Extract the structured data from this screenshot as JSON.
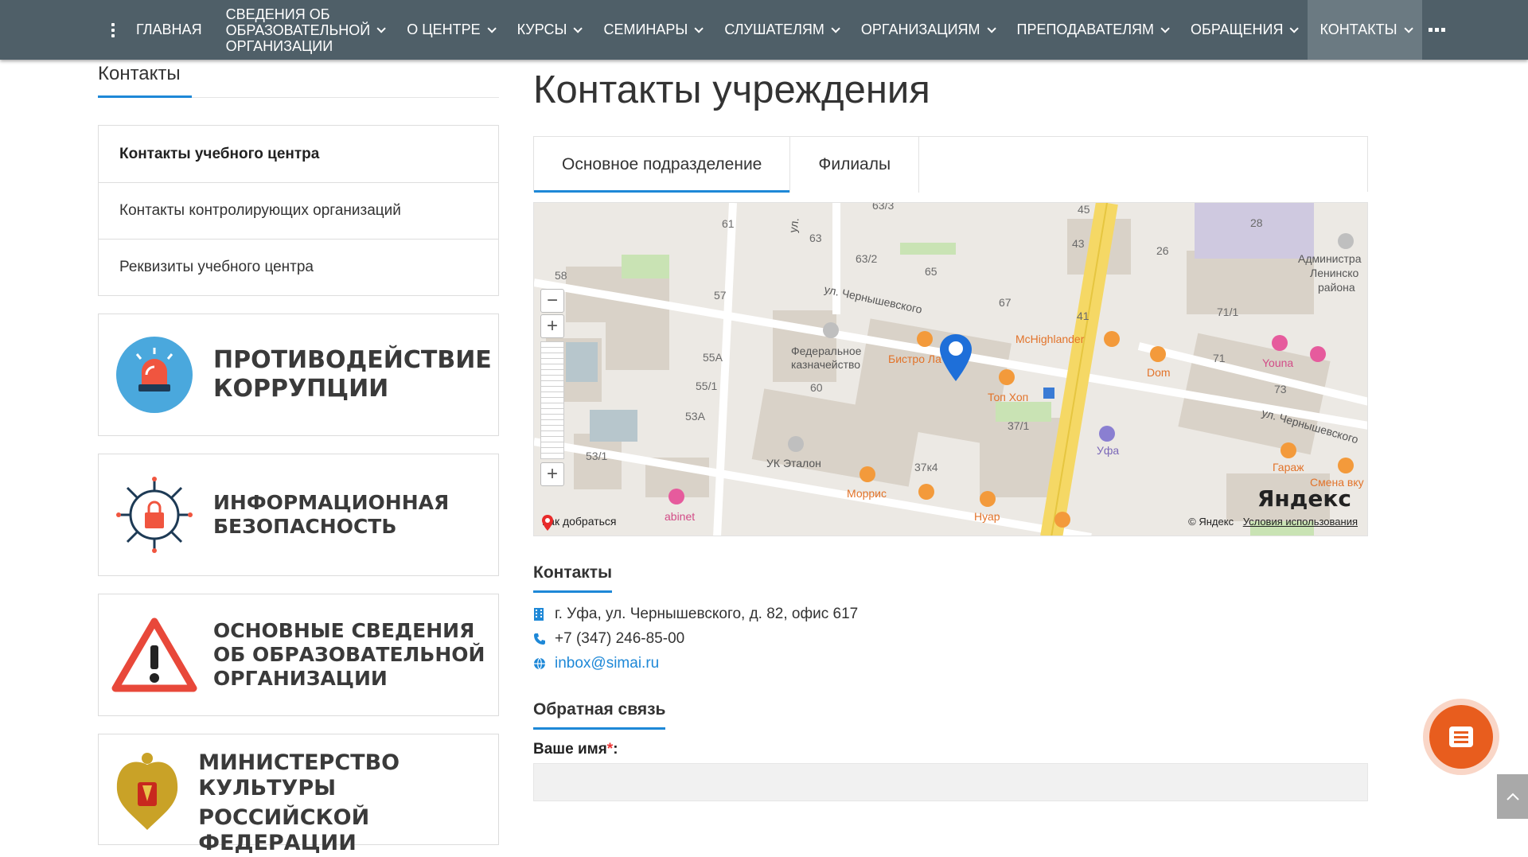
{
  "nav": {
    "items": [
      {
        "label": "ГЛАВНАЯ",
        "chevron": false
      },
      {
        "label": "СВЕДЕНИЯ ОБ ОБРАЗОВАТЕЛЬНОЙ ОРГАНИЗАЦИИ",
        "chevron": true
      },
      {
        "label": "О ЦЕНТРЕ",
        "chevron": true
      },
      {
        "label": "КУРСЫ",
        "chevron": true
      },
      {
        "label": "СЕМИНАРЫ",
        "chevron": true
      },
      {
        "label": "СЛУШАТЕЛЯМ",
        "chevron": true
      },
      {
        "label": "ОРГАНИЗАЦИЯМ",
        "chevron": true
      },
      {
        "label": "ПРЕПОДАВАТЕЛЯМ",
        "chevron": true
      },
      {
        "label": "ОБРАЩЕНИЯ",
        "chevron": true
      },
      {
        "label": "КОНТАКТЫ",
        "chevron": true
      }
    ],
    "nav_item_2_line1": "СВЕДЕНИЯ ОБ",
    "nav_item_2_line2": "ОБРАЗОВАТЕЛЬНОЙ",
    "nav_item_2_line3": "ОРГАНИЗАЦИИ",
    "active": "КОНТАКТЫ"
  },
  "sidebar": {
    "title": "Контакты",
    "menu": [
      "Контакты учебного центра",
      "Контакты контролирующих организаций",
      "Реквизиты учебного центра"
    ],
    "banners": [
      {
        "line1": "ПРОТИВОДЕЙСТВИЕ",
        "line2": "КОРРУПЦИИ",
        "icon": "siren-icon"
      },
      {
        "line1": "ИНФОРМАЦИОННАЯ",
        "line2": "БЕЗОПАСНОСТЬ",
        "icon": "lock-circuit-icon"
      },
      {
        "line1": "ОСНОВНЫЕ СВЕДЕНИЯ",
        "line2": "ОБ ОБРАЗОВАТЕЛЬНОЙ",
        "line3": "ОРГАНИЗАЦИИ",
        "icon": "warning-icon"
      },
      {
        "line1": "МИНИСТЕРСТВО КУЛЬТУРЫ",
        "line2": "РОССИЙСКОЙ ФЕДЕРАЦИИ",
        "icon": "coat-of-arms-icon"
      }
    ]
  },
  "main": {
    "title": "Контакты учреждения",
    "tabs": [
      "Основное подразделение",
      "Филиалы"
    ],
    "map": {
      "labels": {
        "n61": "61",
        "n63_3": "63/3",
        "n63": "63",
        "n63_2": "63/2",
        "n65": "65",
        "n45": "45",
        "n43": "43",
        "n28": "28",
        "n26": "26",
        "n58": "58",
        "n57": "57",
        "n67": "67",
        "n41": "41",
        "n71_1": "71/1",
        "n55a": "55А",
        "n55_1": "55/1",
        "n53a": "53А",
        "n60": "60",
        "n53_1": "53/1",
        "n37_1": "37/1",
        "n37k4": "37к4",
        "n71": "71",
        "n73": "73",
        "street_ul": "ул.",
        "street1": "ул. Чернышевского",
        "street2": "ул. Чернышевского",
        "adm1": "Администра",
        "adm2": "Ленинско",
        "adm3": "района",
        "fed1": "Федеральное",
        "fed2": "казначейство",
        "bistro": "Бистро Ла",
        "mch": "McHighlander",
        "dom": "Dom",
        "youna": "Youna",
        "tonxon": "Топ Хоп",
        "ufa": "Уфа",
        "garazh": "Гараж",
        "smena": "Смена вку",
        "uketalon": "УК Эталон",
        "morris": "Моррис",
        "nuar": "Нуар",
        "cabinet": "abinet"
      },
      "route_label": "Как добраться",
      "copyright": "© Яндекс",
      "terms_link": "Условия использования",
      "logo": "Яндекс"
    },
    "contacts_heading": "Контакты",
    "address": "г. Уфа, ул. Чернышевского, д. 82, офис 617",
    "phone": "+7 (347) 246-85-00",
    "email": "inbox@simai.ru",
    "feedback_heading": "Обратная связь",
    "name_label": "Ваше имя",
    "required_mark": "*",
    "label_colon": ":"
  },
  "colors": {
    "nav_bg": "#4f5f68",
    "accent": "#1e88d7",
    "fab": "#e85d1e"
  }
}
